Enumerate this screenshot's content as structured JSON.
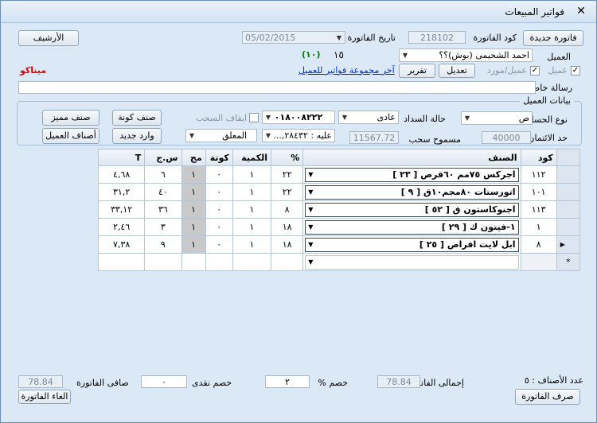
{
  "window": {
    "title": "فواتير المبيعات",
    "close": "✕"
  },
  "toolbar": {
    "new_invoice": "فاتورة جديدة",
    "archive": "الأرشيف"
  },
  "header": {
    "invoice_code_label": "كود الفاتورة",
    "invoice_code": "218102",
    "invoice_date_label": "تاريخ الفاتورة",
    "invoice_date": "05/02/2015",
    "customer_label": "العميل",
    "customer_value": "احمد الشحيمى (بوش)؟؟",
    "count_main": "١٥",
    "count_green": "(١٠)",
    "chk_customer_label": "عميل",
    "chk_customer_supplier_label": "عميل/مورد",
    "btn_edit": "تعديل",
    "btn_report": "تقرير",
    "last_group_link": "آخر مجموعة فواتير للعميل",
    "red_label": "ميناكو",
    "special_msg_label": "رسالة خاصة",
    "special_msg_value": ""
  },
  "customer_data": {
    "group_title": "بيانات العميل",
    "account_type_label": "نوع الحساب",
    "account_type_value": "ص",
    "payment_status_label": "حالة السداد",
    "payment_status_value": "عادى",
    "phone_value": "٠١٨٠٠٨٢٢٢",
    "stop_withdraw_label": "ايقاف السحب",
    "credit_limit_label": "حد الائتمان",
    "credit_limit_value": "40000",
    "allowed_withdraw_label": "مسموح سحب",
    "allowed_withdraw_value": "11567.72",
    "balance_value": "عليه : ٢٨٤٣٢,...",
    "hold_value": "المعلق",
    "btn_coupon_class": "صنف كونة",
    "btn_special_class": "صنف مميز",
    "btn_new_arrival": "وارد جديد",
    "btn_customer_classes": "أصناف العميل"
  },
  "grid": {
    "columns": {
      "code": "كود",
      "item": "الصنف",
      "percent": "%",
      "qty": "الكمية",
      "kota": "كوتة",
      "mj": "مج",
      "price": "س.ج",
      "total": "T"
    },
    "rows": [
      {
        "code": "١١٢",
        "item": "اجركس ٧٥مم ٦٠قرص  [ ٢٣ ]",
        "percent": "٢٢",
        "qty": "١",
        "kota": "٠",
        "mj": "١",
        "price": "٦",
        "total": "٤,٦٨"
      },
      {
        "code": "١٠١",
        "item": "اتورستات ٨٠مجم١٠ق [ ٩ ]",
        "percent": "٢٢",
        "qty": "١",
        "kota": "٠",
        "mj": "١",
        "price": "٤٠",
        "total": "٣١,٢"
      },
      {
        "code": "١١٣",
        "item": "اجنوكاستون ق [ ٥٢ ]",
        "percent": "٨",
        "qty": "١",
        "kota": "٠",
        "mj": "١",
        "price": "٣٦",
        "total": "٣٣,١٢"
      },
      {
        "code": "١",
        "item": "١-فيتون ك [ ٢٩ ]",
        "percent": "١٨",
        "qty": "١",
        "kota": "٠",
        "mj": "١",
        "price": "٣",
        "total": "٢,٤٦"
      },
      {
        "code": "٨",
        "item": "ابل لايت اقراص [ ٢٥ ]",
        "percent": "١٨",
        "qty": "١",
        "kota": "٠",
        "mj": "١",
        "price": "٩",
        "total": "٧,٣٨"
      }
    ],
    "new_row_marker": "*",
    "current_row_marker": "▶"
  },
  "footer": {
    "items_count_label": "عدد الأصناف : ٥",
    "invoice_total_label": "إجمالى الفاتورة",
    "invoice_total": "78.84",
    "discount_pct_label": "خصم %",
    "discount_pct": "٢",
    "cash_discount_label": "خصم نقدى",
    "cash_discount": "٠",
    "net_label": "صافى الفاتورة",
    "net_value": "78.84",
    "btn_dispense": "صرف الفاتورة",
    "btn_cancel": "الغاء الفاتورة"
  },
  "colors": {
    "window_bg": "#dbe8f5",
    "link": "#0033cc",
    "red": "#e00000",
    "green": "#008000"
  }
}
